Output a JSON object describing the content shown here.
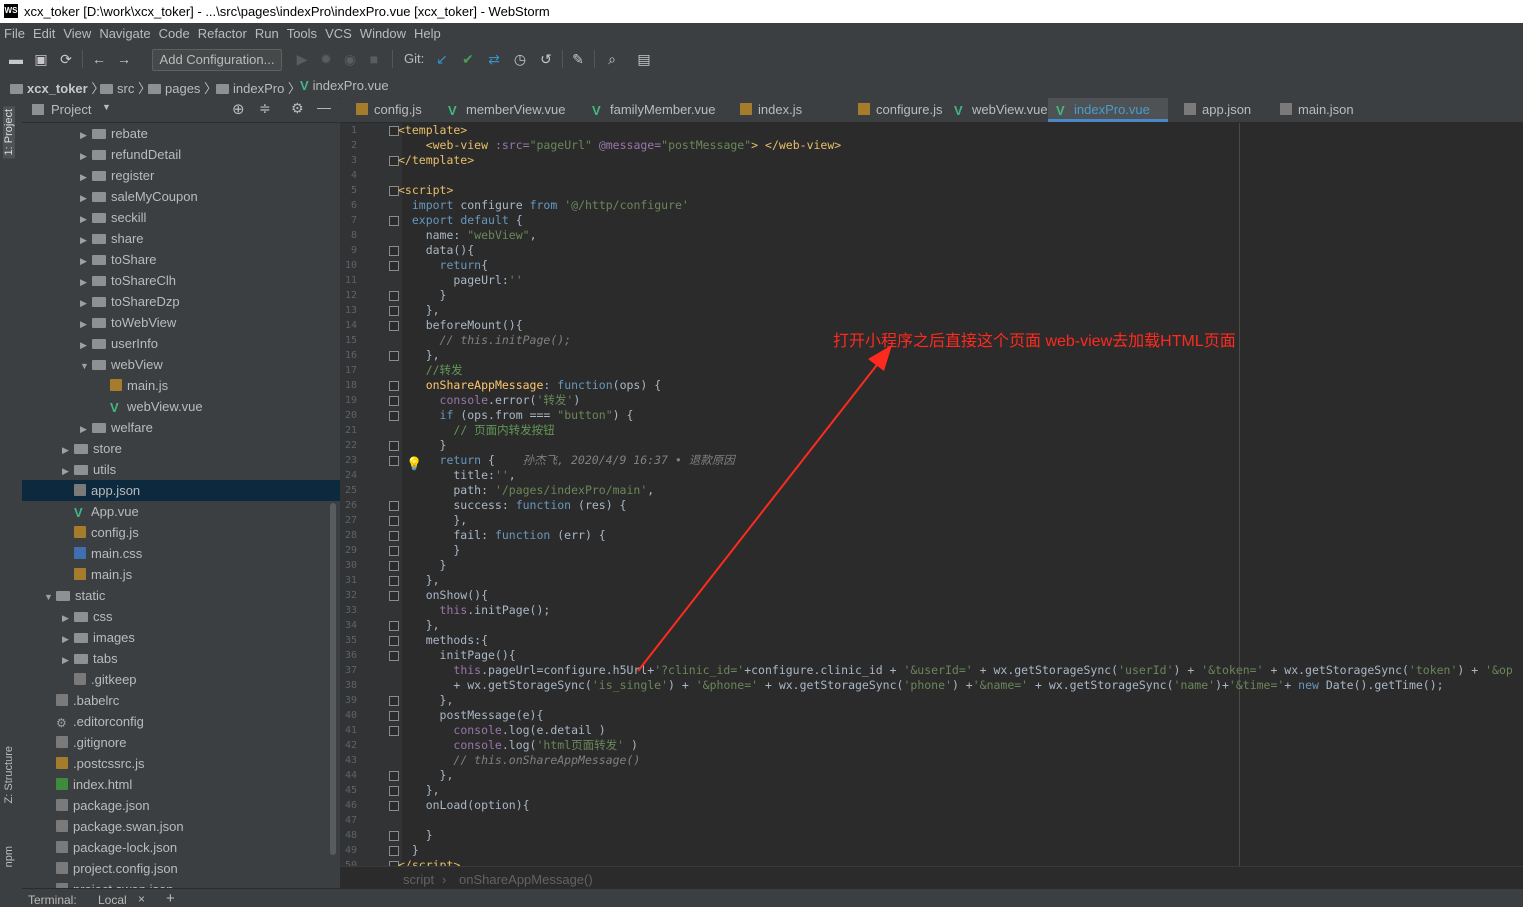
{
  "window": {
    "logo": "WS",
    "title": "xcx_toker [D:\\work\\xcx_toker] - ...\\src\\pages\\indexPro\\indexPro.vue [xcx_toker] - WebStorm"
  },
  "menu": [
    "File",
    "Edit",
    "View",
    "Navigate",
    "Code",
    "Refactor",
    "Run",
    "Tools",
    "VCS",
    "Window",
    "Help"
  ],
  "toolbar": {
    "add_configuration": "Add Configuration...",
    "git_label": "Git:"
  },
  "breadcrumb": [
    "xcx_toker",
    "src",
    "pages",
    "indexPro",
    "indexPro.vue"
  ],
  "side_tabs": {
    "project": "1: Project",
    "structure": "Z: Structure",
    "npm": "npm"
  },
  "project_panel": {
    "title": "Project",
    "tree": [
      {
        "label": "rebate",
        "type": "folder",
        "depth": 3,
        "arrow": "▶"
      },
      {
        "label": "refundDetail",
        "type": "folder",
        "depth": 3,
        "arrow": "▶"
      },
      {
        "label": "register",
        "type": "folder",
        "depth": 3,
        "arrow": "▶"
      },
      {
        "label": "saleMyCoupon",
        "type": "folder",
        "depth": 3,
        "arrow": "▶"
      },
      {
        "label": "seckill",
        "type": "folder",
        "depth": 3,
        "arrow": "▶"
      },
      {
        "label": "share",
        "type": "folder",
        "depth": 3,
        "arrow": "▶"
      },
      {
        "label": "toShare",
        "type": "folder",
        "depth": 3,
        "arrow": "▶"
      },
      {
        "label": "toShareClh",
        "type": "folder",
        "depth": 3,
        "arrow": "▶"
      },
      {
        "label": "toShareDzp",
        "type": "folder",
        "depth": 3,
        "arrow": "▶"
      },
      {
        "label": "toWebView",
        "type": "folder",
        "depth": 3,
        "arrow": "▶"
      },
      {
        "label": "userInfo",
        "type": "folder",
        "depth": 3,
        "arrow": "▶"
      },
      {
        "label": "webView",
        "type": "folder",
        "depth": 3,
        "arrow": "▼"
      },
      {
        "label": "main.js",
        "type": "js",
        "depth": 4,
        "arrow": ""
      },
      {
        "label": "webView.vue",
        "type": "vue",
        "depth": 4,
        "arrow": ""
      },
      {
        "label": "welfare",
        "type": "folder",
        "depth": 3,
        "arrow": "▶"
      },
      {
        "label": "store",
        "type": "folder",
        "depth": 2,
        "arrow": "▶"
      },
      {
        "label": "utils",
        "type": "folder",
        "depth": 2,
        "arrow": "▶"
      },
      {
        "label": "app.json",
        "type": "json",
        "depth": 2,
        "arrow": "",
        "selected": true
      },
      {
        "label": "App.vue",
        "type": "vue",
        "depth": 2,
        "arrow": ""
      },
      {
        "label": "config.js",
        "type": "js",
        "depth": 2,
        "arrow": ""
      },
      {
        "label": "main.css",
        "type": "css",
        "depth": 2,
        "arrow": ""
      },
      {
        "label": "main.js",
        "type": "js",
        "depth": 2,
        "arrow": ""
      },
      {
        "label": "static",
        "type": "folder",
        "depth": 1,
        "arrow": "▼"
      },
      {
        "label": "css",
        "type": "folder",
        "depth": 2,
        "arrow": "▶"
      },
      {
        "label": "images",
        "type": "folder",
        "depth": 2,
        "arrow": "▶"
      },
      {
        "label": "tabs",
        "type": "folder",
        "depth": 2,
        "arrow": "▶"
      },
      {
        "label": ".gitkeep",
        "type": "json",
        "depth": 2,
        "arrow": ""
      },
      {
        "label": ".babelrc",
        "type": "json",
        "depth": 1,
        "arrow": ""
      },
      {
        "label": ".editorconfig",
        "type": "gear",
        "depth": 1,
        "arrow": ""
      },
      {
        "label": ".gitignore",
        "type": "json",
        "depth": 1,
        "arrow": ""
      },
      {
        "label": ".postcssrc.js",
        "type": "js",
        "depth": 1,
        "arrow": ""
      },
      {
        "label": "index.html",
        "type": "html",
        "depth": 1,
        "arrow": ""
      },
      {
        "label": "package.json",
        "type": "json",
        "depth": 1,
        "arrow": ""
      },
      {
        "label": "package.swan.json",
        "type": "json",
        "depth": 1,
        "arrow": ""
      },
      {
        "label": "package-lock.json",
        "type": "json",
        "depth": 1,
        "arrow": ""
      },
      {
        "label": "project.config.json",
        "type": "json",
        "depth": 1,
        "arrow": ""
      },
      {
        "label": "project.swan.json",
        "type": "json",
        "depth": 1,
        "arrow": ""
      }
    ]
  },
  "tabs": [
    {
      "label": "config.js",
      "type": "js",
      "active": false
    },
    {
      "label": "memberView.vue",
      "type": "vue",
      "active": false
    },
    {
      "label": "familyMember.vue",
      "type": "vue",
      "active": false
    },
    {
      "label": "index.js",
      "type": "js",
      "active": false
    },
    {
      "label": "configure.js",
      "type": "js",
      "active": false
    },
    {
      "label": "webView.vue",
      "type": "vue",
      "active": false
    },
    {
      "label": "indexPro.vue",
      "type": "vue",
      "active": true
    },
    {
      "label": "app.json",
      "type": "json",
      "active": false
    },
    {
      "label": "main.json",
      "type": "json",
      "active": false
    }
  ],
  "code_lines": [
    "<span class=\"tg\">&lt;template&gt;</span>",
    "    <span class=\"tg\">&lt;web-view</span> <span class=\"pr\">:src=</span><span class=\"st\">\"pageUrl\"</span> <span class=\"pr\">@message=</span><span class=\"st\">\"postMessage\"</span><span class=\"tg\">&gt;</span> <span class=\"tg\">&lt;/web-view&gt;</span>",
    "<span class=\"tg\">&lt;/template&gt;</span>",
    "",
    "<span class=\"tg\">&lt;script&gt;</span>",
    "  <span class=\"kb\">import</span> configure <span class=\"kb\">from</span> <span class=\"st\">'@/http/configure'</span>",
    "  <span class=\"kb\">export default</span> {",
    "    name: <span class=\"st\">\"webView\"</span>,",
    "    data(){",
    "      <span class=\"kb\">return</span>{",
    "        pageUrl:<span class=\"st\">''</span>",
    "      }",
    "    },",
    "    beforeMount(){",
    "      <span class=\"gi\">// this.initPage();</span>",
    "    },",
    "    <span class=\"cm\">//转发</span>",
    "    <span class=\"fn\">onShareAppMessage</span>: <span class=\"kb\">function</span>(ops) {",
    "      <span class=\"pr\">console</span>.error(<span class=\"st\">'转发'</span>)",
    "      <span class=\"kb\">if</span> (ops.from === <span class=\"st\">\"button\"</span>) {",
    "        <span class=\"cm\">// 页面内转发按钮</span>",
    "      }",
    "      <span class=\"kb\">return</span> {    <span class=\"gi\">孙杰飞, 2020/4/9 16:37 • 退款原因</span>",
    "        title:<span class=\"st\">''</span>,",
    "        path: <span class=\"st\">'/pages/indexPro/main'</span>,",
    "        success: <span class=\"kb\">function</span> (res) {",
    "        },",
    "        fail: <span class=\"kb\">function</span> (err) {",
    "        }",
    "      }",
    "    },",
    "    onShow(){",
    "      <span class=\"pr\">this</span>.initPage();",
    "    },",
    "    methods:{",
    "      initPage(){",
    "        <span class=\"pr\">this</span>.pageUrl=configure.h5Url+<span class=\"st\">'?clinic_id='</span>+configure.clinic_id + <span class=\"st\">'&amp;userId='</span> + wx.getStorageSync(<span class=\"st\">'userId'</span>) + <span class=\"st\">'&amp;token='</span> + wx.getStorageSync(<span class=\"st\">'token'</span>) + <span class=\"st\">'&amp;op</span>",
    "        + wx.getStorageSync(<span class=\"st\">'is_single'</span>) + <span class=\"st\">'&amp;phone='</span> + wx.getStorageSync(<span class=\"st\">'phone'</span>) +<span class=\"st\">'&amp;name='</span> + wx.getStorageSync(<span class=\"st\">'name'</span>)+<span class=\"st\">'&amp;time='</span>+ <span class=\"kb\">new</span> Date().getTime();",
    "      },",
    "      postMessage(e){",
    "        <span class=\"pr\">console</span>.log(e.detail )",
    "        <span class=\"pr\">console</span>.log(<span class=\"st\">'html页面转发'</span> )",
    "        <span class=\"gi\">// this.onShareAppMessage()</span>",
    "      },",
    "    },",
    "    onLoad(option){",
    "",
    "    }",
    "  }",
    "<span class=\"tg\">&lt;/script&gt;</span>"
  ],
  "line_numbers": [
    "1",
    "2",
    "3",
    "4",
    "5",
    "6",
    "7",
    "8",
    "9",
    "10",
    "11",
    "12",
    "13",
    "14",
    "15",
    "16",
    "17",
    "18",
    "19",
    "20",
    "21",
    "22",
    "23",
    "24",
    "25",
    "26",
    "27",
    "28",
    "29",
    "30",
    "31",
    "32",
    "33",
    "34",
    "35",
    "36",
    "37",
    "38",
    "39",
    "40",
    "41",
    "42",
    "43",
    "44",
    "45",
    "46",
    "47",
    "48",
    "49",
    "50"
  ],
  "annotation": {
    "text": "打开小程序之后直接这个页面   web-view去加载HTML页面",
    "color": "#ff2a1f"
  },
  "editor_breadcrumb": [
    "script",
    "onShareAppMessage()"
  ],
  "bottom_bar": {
    "terminal": "Terminal:",
    "local": "Local"
  },
  "colors": {
    "accent": "#4a88c7",
    "editor_bg": "#2b2b2b",
    "panel_bg": "#3c3f41",
    "selection": "#0d293e"
  }
}
